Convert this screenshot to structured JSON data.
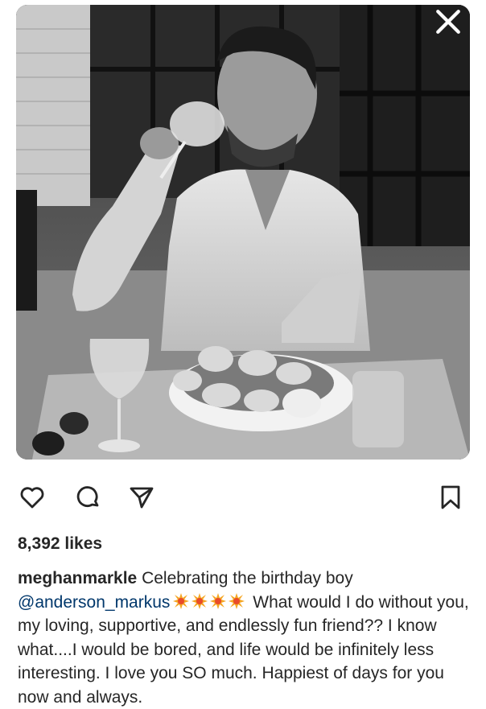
{
  "post": {
    "image_alt": "Black and white photo of a man drinking from a wine glass at an outdoor table with a plate of oysters",
    "close_icon": "close-icon",
    "actions": {
      "like_icon": "heart-icon",
      "comment_icon": "comment-icon",
      "share_icon": "send-icon",
      "save_icon": "bookmark-icon"
    },
    "likes": "8,392 likes",
    "caption": {
      "username": "meghanmarkle",
      "text_1": " Celebrating the birthday boy ",
      "mention": "@anderson_markus",
      "emoji_name": "collision-emoji",
      "emoji_count": 4,
      "text_2": " What would I do without you, my loving, supportive, and endlessly fun friend?? I know what....I would be bored, and life would be infinitely less interesting.  I love you SO much. Happiest of days for you now and always."
    }
  },
  "colors": {
    "text": "#262626",
    "mention": "#00376b",
    "emoji_orange": "#f5a623",
    "emoji_red": "#e94b2a"
  }
}
